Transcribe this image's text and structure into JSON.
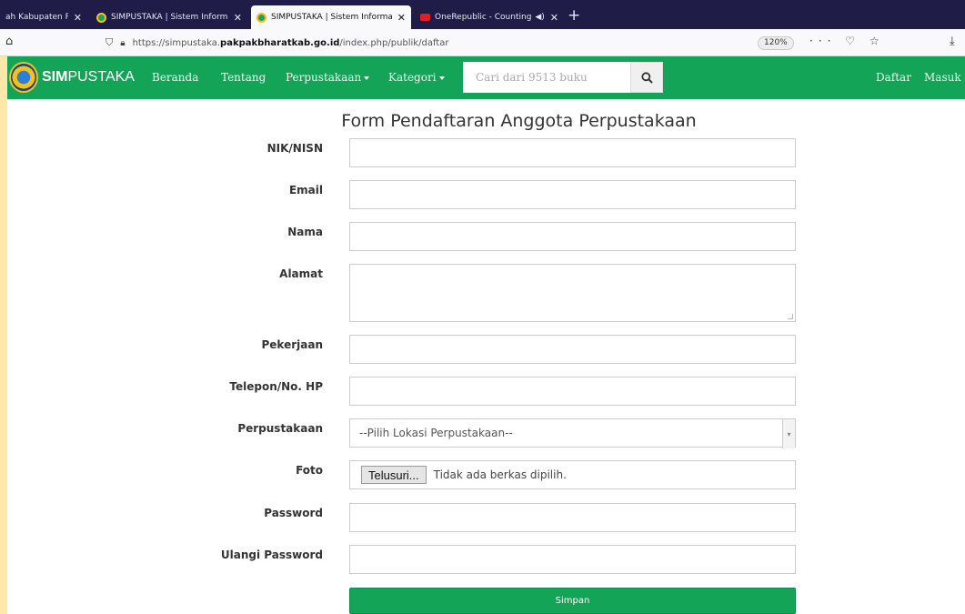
{
  "browser": {
    "tabs": [
      {
        "title": "ah Kabupaten Pa",
        "active": false
      },
      {
        "title": "SIMPUSTAKA | Sistem Informasi",
        "active": false
      },
      {
        "title": "SIMPUSTAKA | Sistem Informasi",
        "active": true
      },
      {
        "title": "OneRepublic - Counting Stars",
        "active": false
      }
    ],
    "new_tab": "+",
    "url_prefix": "https://simpustaka.",
    "url_host": "pakpakbharatkab.go.id",
    "url_path": "/index.php/publik/daftar",
    "zoom": "120%",
    "page_actions": "··· ♡ ☆"
  },
  "site": {
    "brand_bold": "SIM",
    "brand_rest": "PUSTAKA",
    "nav": {
      "beranda": "Beranda",
      "tentang": "Tentang",
      "perpustakaan": "Perpustakaan",
      "kategori": "Kategori",
      "daftar": "Daftar",
      "masuk": "Masuk"
    },
    "search": {
      "placeholder": "Cari dari 9513 buku"
    }
  },
  "form": {
    "title": "Form Pendaftaran Anggota Perpustakaan",
    "labels": {
      "nik": "NIK/NISN",
      "email": "Email",
      "nama": "Nama",
      "alamat": "Alamat",
      "pekerjaan": "Pekerjaan",
      "telepon": "Telepon/No. HP",
      "perpustakaan": "Perpustakaan",
      "foto": "Foto",
      "password": "Password",
      "ulangi_password": "Ulangi Password"
    },
    "perpustakaan_selected": "--Pilih Lokasi Perpustakaan--",
    "browse_label": "Telusuri...",
    "file_status": "Tidak ada berkas dipilih.",
    "submit_label": "Simpan"
  },
  "colors": {
    "brand_green": "#13a457",
    "tab_bar": "#1f1d47",
    "page_margin": "#fde8a8"
  }
}
